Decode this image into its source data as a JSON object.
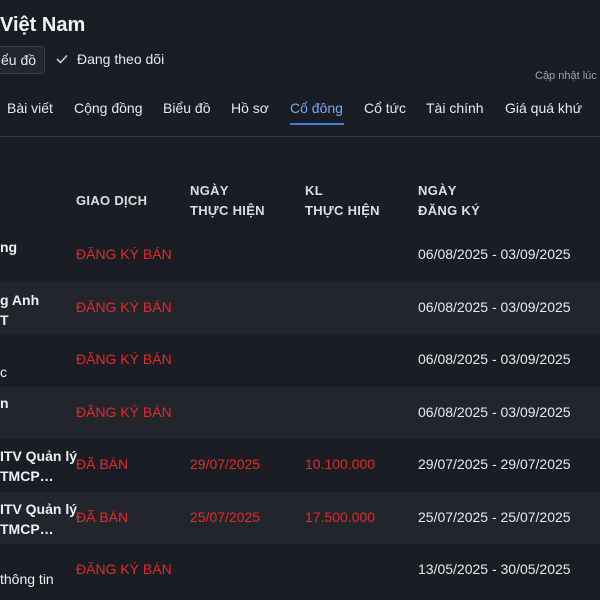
{
  "header": {
    "title": "Việt Nam",
    "chart_button": "ểu đồ",
    "follow_label": "Đang theo dõi",
    "updated_label": "Cập nhật lúc"
  },
  "tabs": [
    {
      "label": "Bài viết"
    },
    {
      "label": "Cộng đồng"
    },
    {
      "label": "Biểu đồ"
    },
    {
      "label": "Hồ sơ"
    },
    {
      "label": "Cổ đông",
      "active": true
    },
    {
      "label": "Cổ tức"
    },
    {
      "label": "Tài chính"
    },
    {
      "label": "Giá quá khứ"
    }
  ],
  "table": {
    "headers": {
      "transaction": "GIAO DỊCH",
      "exec_date_1": "NGÀY",
      "exec_date_2": "THỰC HIỆN",
      "volume_1": "KL",
      "volume_2": "THỰC HIỆN",
      "reg_date_1": "NGÀY",
      "reg_date_2": "ĐĂNG KÝ"
    },
    "rows": [
      {
        "name_1": "ng",
        "name_2": "",
        "transaction": "ĐĂNG KÝ BÁN",
        "exec_date": "",
        "volume": "",
        "reg_date": "06/08/2025 - 03/09/2025"
      },
      {
        "name_1": "g Anh",
        "name_2": "T",
        "transaction": "ĐĂNG KÝ BÁN",
        "exec_date": "",
        "volume": "",
        "reg_date": "06/08/2025 - 03/09/2025"
      },
      {
        "name_1": "",
        "name_2": "c",
        "transaction": "ĐĂNG KÝ BÁN",
        "exec_date": "",
        "volume": "",
        "reg_date": "06/08/2025 - 03/09/2025"
      },
      {
        "name_1": "n",
        "name_2": "",
        "transaction": "ĐĂNG KÝ BÁN",
        "exec_date": "",
        "volume": "",
        "reg_date": "06/08/2025 - 03/09/2025"
      },
      {
        "name_1": "ITV Quản lý",
        "name_2": "TMCP…",
        "transaction": "ĐÃ BÁN",
        "exec_date": "29/07/2025",
        "volume": "10.100.000",
        "reg_date": "29/07/2025 - 29/07/2025"
      },
      {
        "name_1": "ITV Quản lý",
        "name_2": "TMCP…",
        "transaction": "ĐÃ BÁN",
        "exec_date": "25/07/2025",
        "volume": "17.500.000",
        "reg_date": "25/07/2025 - 25/07/2025"
      },
      {
        "name_1": "",
        "name_2": "thông tin",
        "transaction": "ĐĂNG KÝ BÁN",
        "exec_date": "",
        "volume": "",
        "reg_date": "13/05/2025 - 30/05/2025"
      }
    ]
  },
  "colors": {
    "background": "#1b1d24",
    "row_alt": "#23252d",
    "accent": "#6ea8f7",
    "sell_red": "#e02b2b"
  },
  "icons": {
    "follow": "check-icon"
  }
}
